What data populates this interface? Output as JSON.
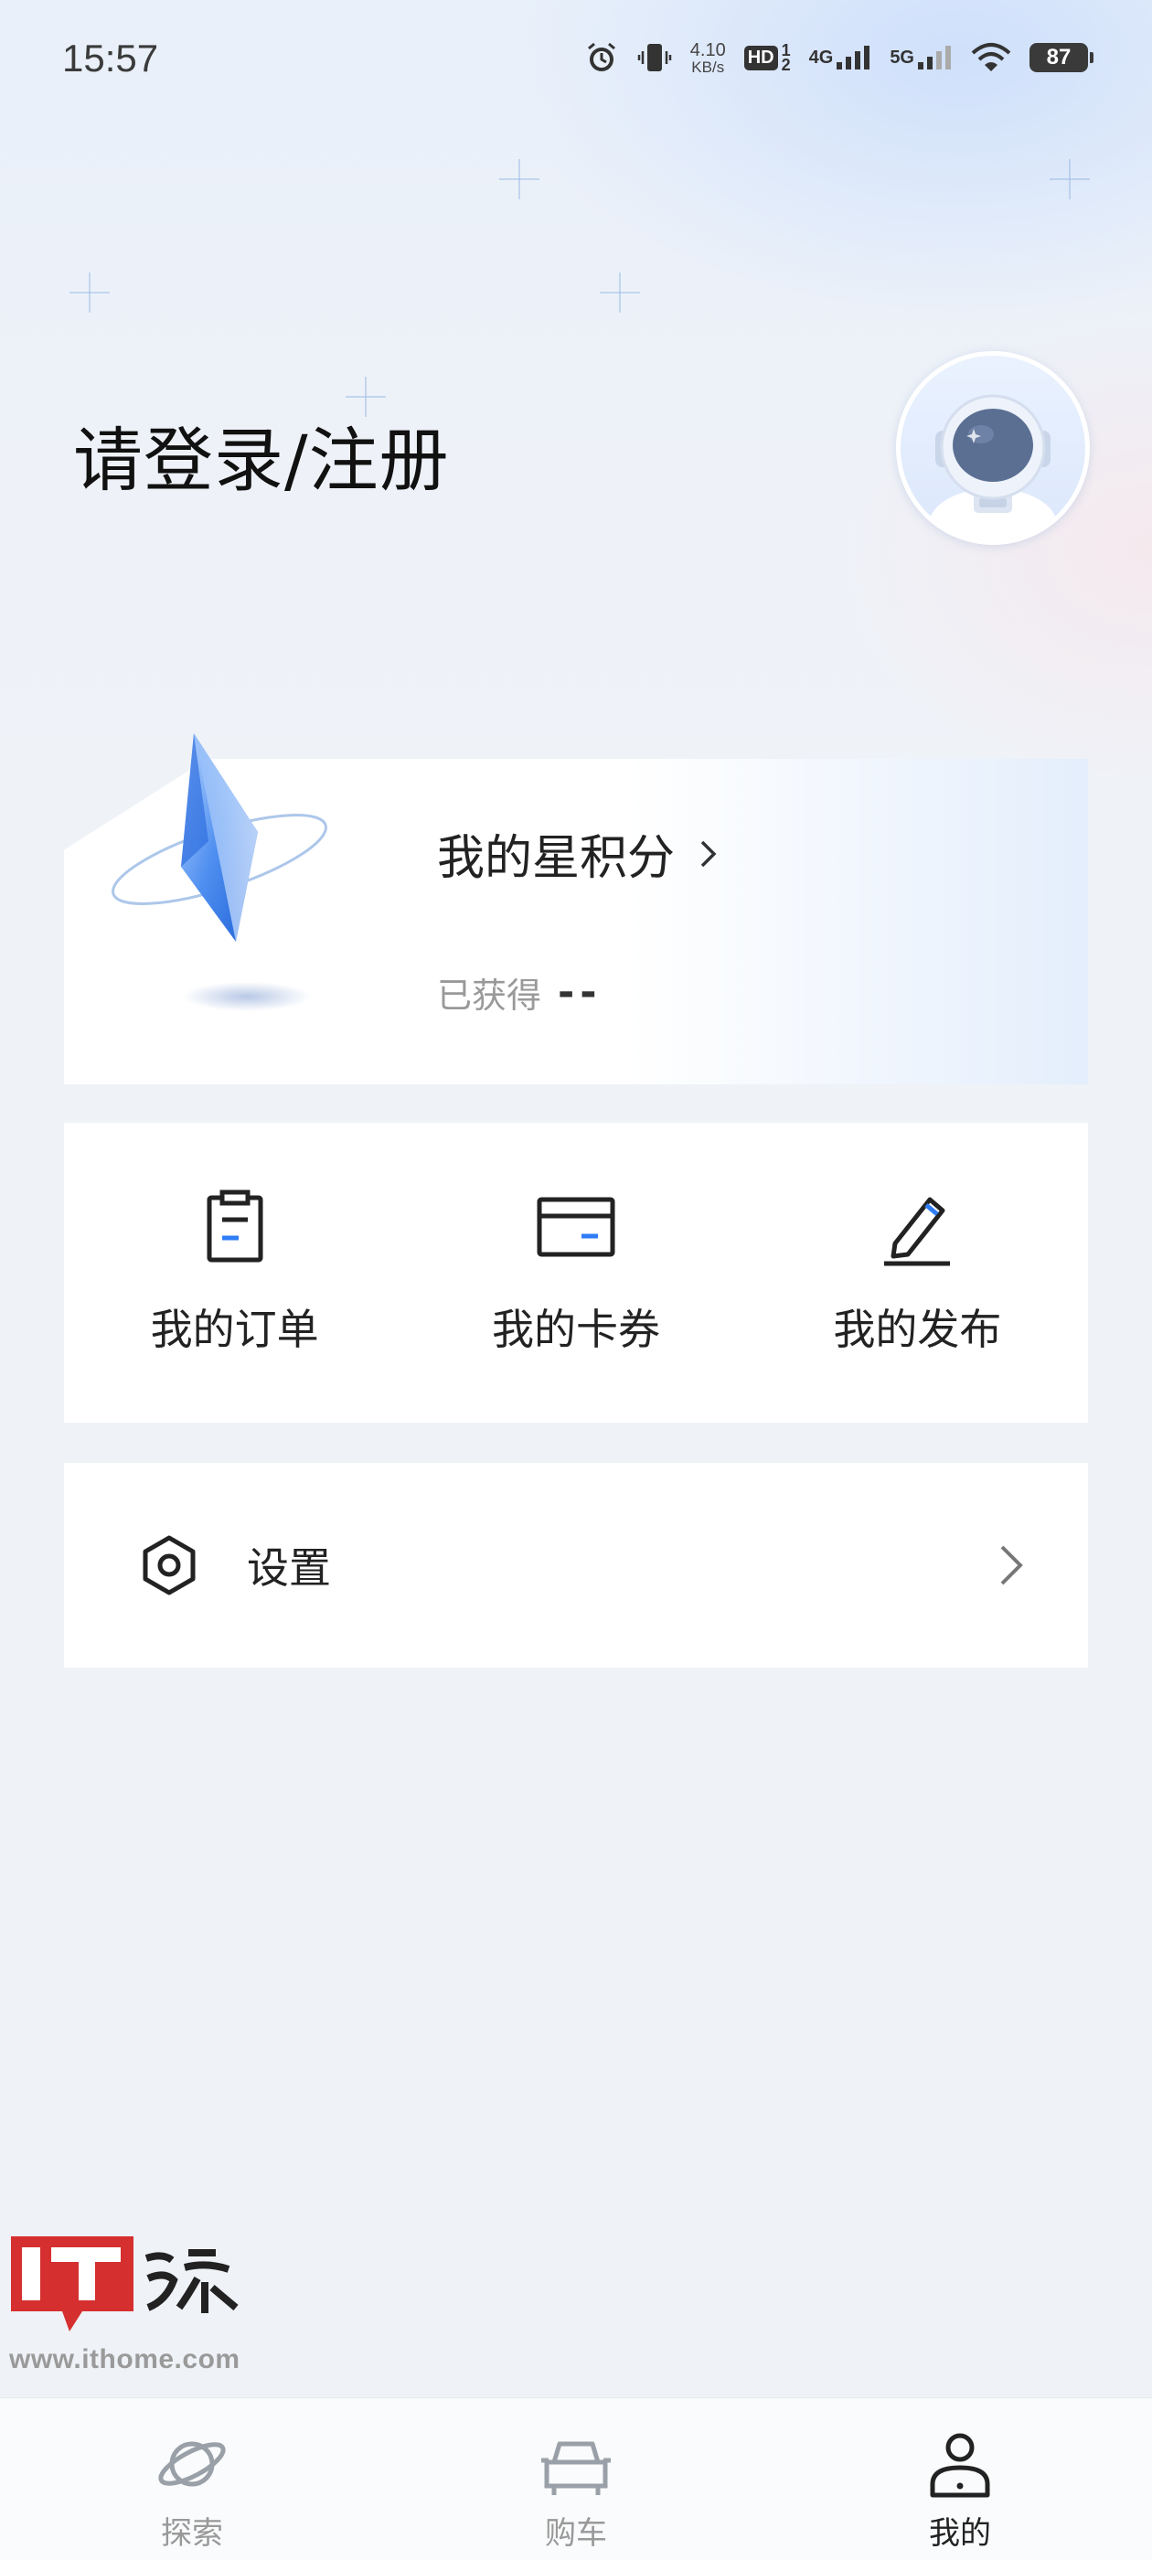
{
  "status_bar": {
    "time": "15:57",
    "net_speed_value": "4.10",
    "net_speed_unit": "KB/s",
    "hd_label": "HD",
    "signal_1_label": "4G",
    "signal_2_label": "5G",
    "battery": "87",
    "icons": [
      "alarm-icon",
      "vibrate-icon",
      "hd-icon",
      "signal-icon",
      "wifi-icon",
      "battery-icon"
    ]
  },
  "header": {
    "login_title": "请登录/注册"
  },
  "points": {
    "title": "我的星积分",
    "earned_label": "已获得",
    "earned_value": "--"
  },
  "shortcuts": [
    {
      "label": "我的订单",
      "icon": "clipboard-icon"
    },
    {
      "label": "我的卡券",
      "icon": "card-icon"
    },
    {
      "label": "我的发布",
      "icon": "pen-icon"
    }
  ],
  "settings": {
    "label": "设置",
    "icon": "gear-icon"
  },
  "watermark": {
    "text": "www.ithome.com"
  },
  "bottom_nav": {
    "items": [
      {
        "label": "探索",
        "icon": "planet-icon",
        "active": false
      },
      {
        "label": "购车",
        "icon": "car-icon",
        "active": false
      },
      {
        "label": "我的",
        "icon": "person-icon",
        "active": true
      }
    ]
  },
  "colors": {
    "accent_blue": "#2f7df6",
    "text_primary": "#222222",
    "text_secondary": "#999999",
    "page_bg": "#eff2f7"
  }
}
